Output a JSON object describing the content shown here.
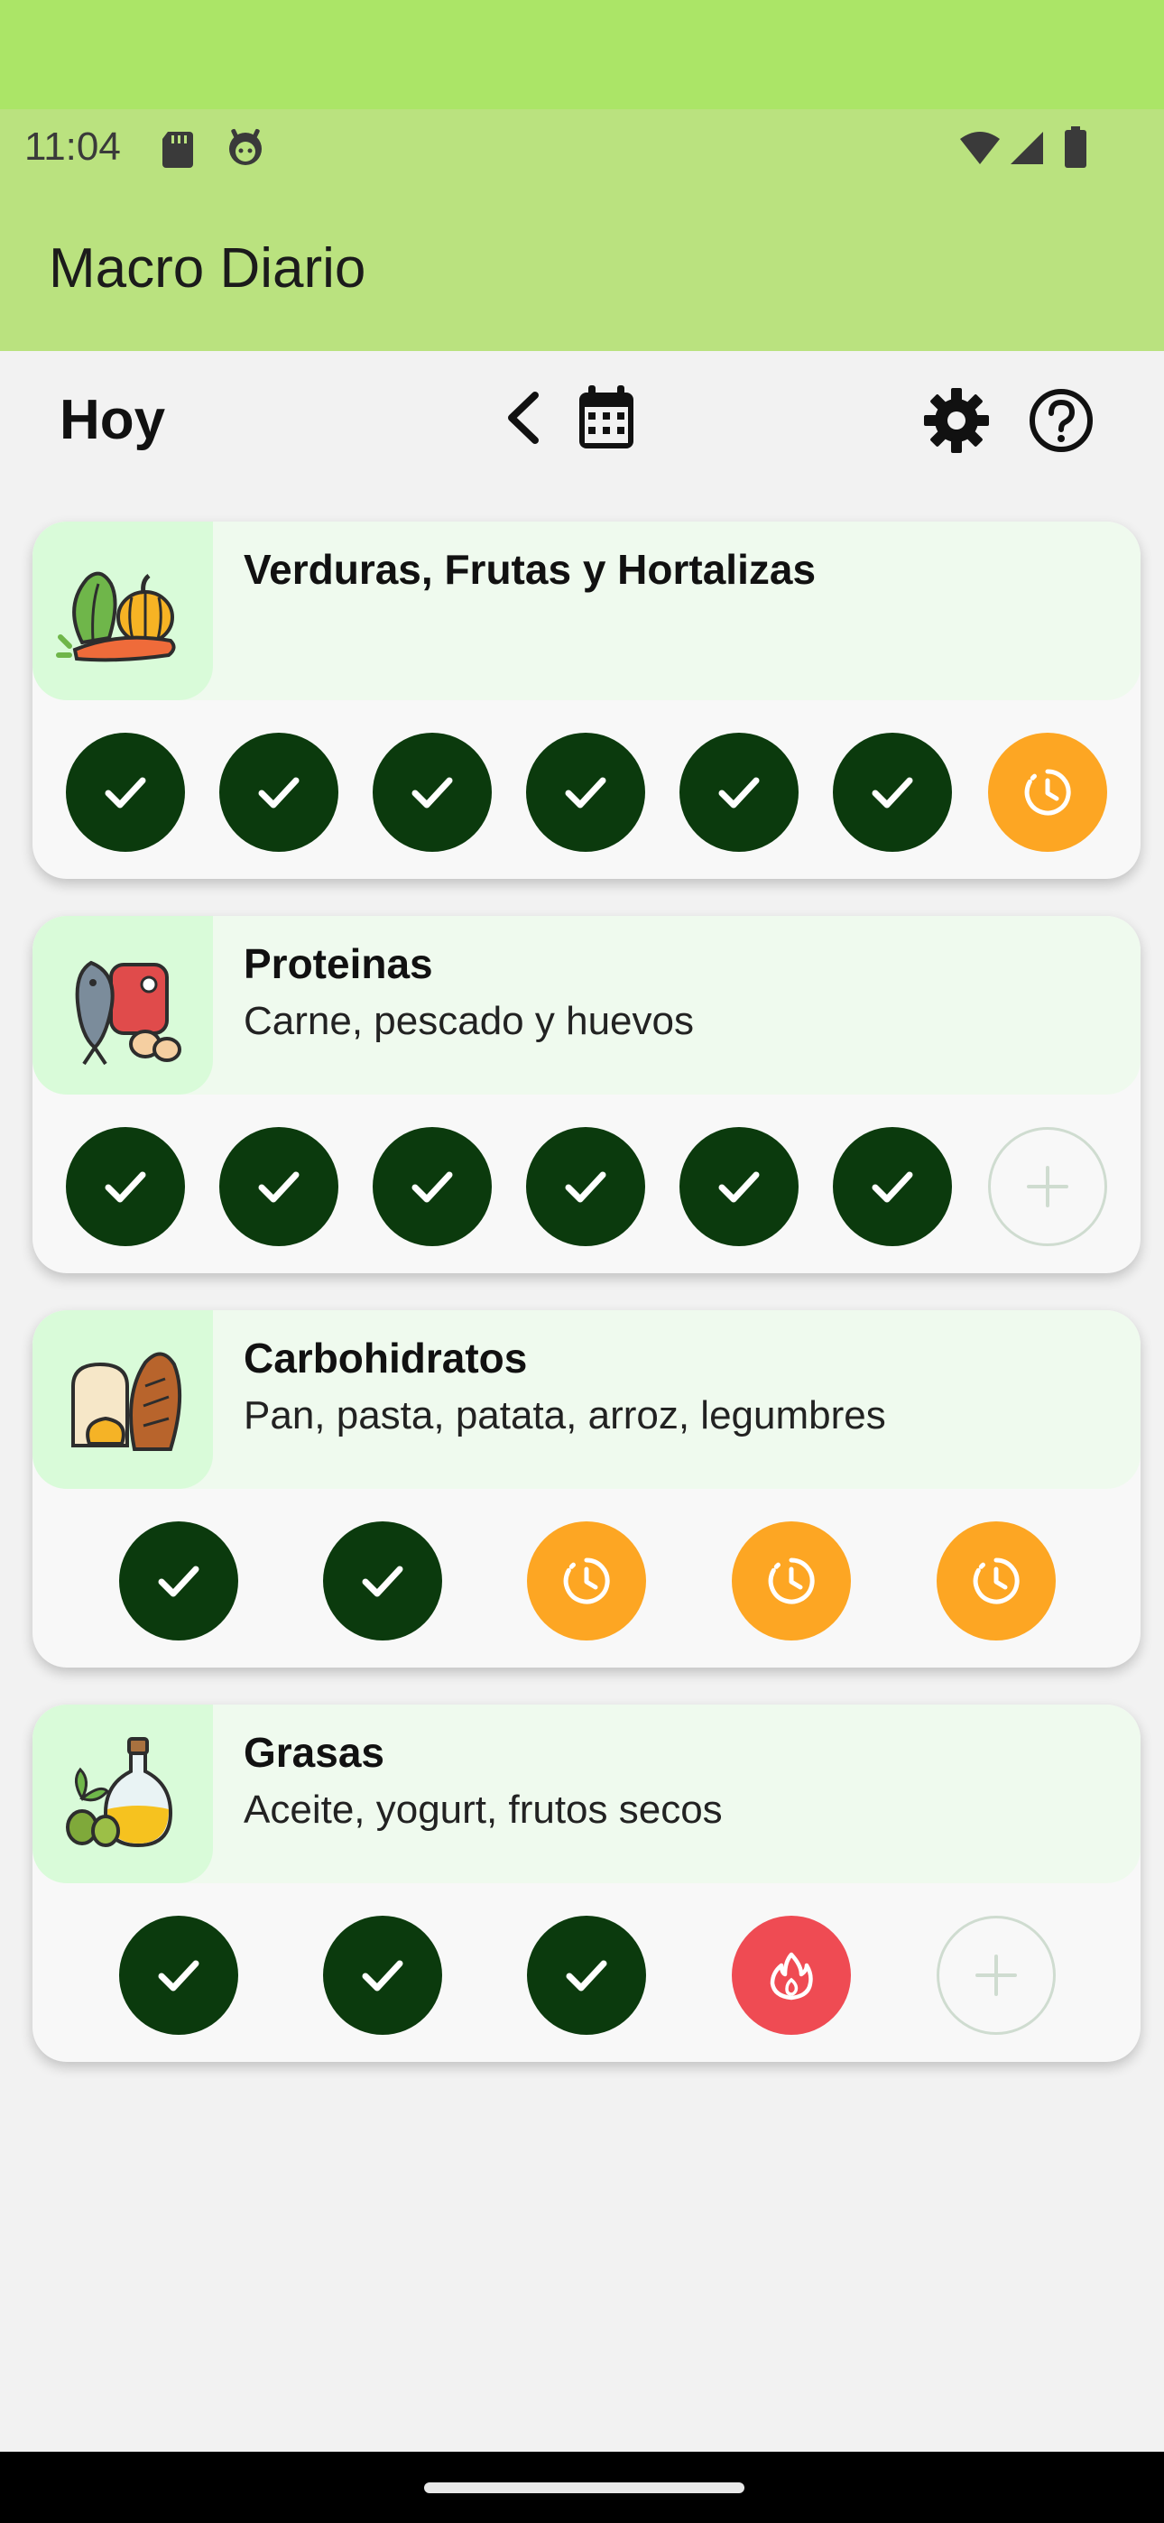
{
  "status": {
    "time": "11:04"
  },
  "app": {
    "title": "Macro Diario"
  },
  "toolbar": {
    "title": "Hoy"
  },
  "categories": [
    {
      "title": "Verduras, Frutas y Hortalizas",
      "subtitle": "",
      "icon": "vegetables-icon",
      "slots": [
        "done",
        "done",
        "done",
        "done",
        "done",
        "done",
        "pending"
      ]
    },
    {
      "title": "Proteinas",
      "subtitle": "Carne, pescado y huevos",
      "icon": "protein-icon",
      "slots": [
        "done",
        "done",
        "done",
        "done",
        "done",
        "done",
        "add"
      ]
    },
    {
      "title": "Carbohidratos",
      "subtitle": "Pan, pasta, patata, arroz, legumbres",
      "icon": "bread-icon",
      "slots": [
        "done",
        "done",
        "pending",
        "pending",
        "pending"
      ]
    },
    {
      "title": "Grasas",
      "subtitle": "Aceite, yogurt, frutos secos",
      "icon": "oil-icon",
      "slots": [
        "done",
        "done",
        "done",
        "fire",
        "add"
      ]
    }
  ],
  "colors": {
    "status_bar": "#bae27f",
    "done": "#0b3a0d",
    "pending": "#fda623",
    "fire": "#ef4b53",
    "card_header": "#effaee"
  }
}
